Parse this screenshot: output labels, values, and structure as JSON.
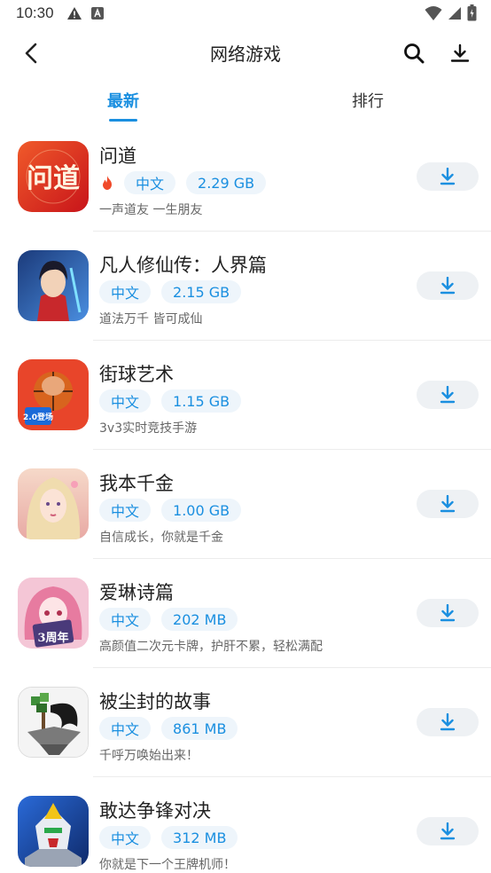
{
  "status": {
    "time": "10:30"
  },
  "appbar": {
    "title": "网络游戏"
  },
  "tabs": [
    {
      "label": "最新",
      "active": true
    },
    {
      "label": "排行",
      "active": false
    }
  ],
  "games": [
    {
      "name": "问道",
      "hot": true,
      "lang": "中文",
      "size": "2.29 GB",
      "desc": "一声道友 一生朋友",
      "icon": "wendao-icon"
    },
    {
      "name": "凡人修仙传：人界篇",
      "hot": false,
      "lang": "中文",
      "size": "2.15 GB",
      "desc": "道法万千 皆可成仙",
      "icon": "fanren-icon"
    },
    {
      "name": "街球艺术",
      "hot": false,
      "lang": "中文",
      "size": "1.15 GB",
      "desc": "3v3实时竞技手游",
      "icon": "jieqiu-icon"
    },
    {
      "name": "我本千金",
      "hot": false,
      "lang": "中文",
      "size": "1.00 GB",
      "desc": "自信成长，你就是千金",
      "icon": "qianjin-icon"
    },
    {
      "name": "爱琳诗篇",
      "hot": false,
      "lang": "中文",
      "size": "202 MB",
      "desc": "高颜值二次元卡牌，护肝不累，轻松满配",
      "icon": "ailin-icon"
    },
    {
      "name": "被尘封的故事",
      "hot": false,
      "lang": "中文",
      "size": "861 MB",
      "desc": "千呼万唤始出来！",
      "icon": "chenfeng-icon"
    },
    {
      "name": "敢达争锋对决",
      "hot": false,
      "lang": "中文",
      "size": "312 MB",
      "desc": "你就是下一个王牌机师！",
      "icon": "gundam-icon"
    }
  ],
  "icon_texts": {
    "wendao": "问道",
    "jieqiu": "2.0登场",
    "ailin": "3周年"
  },
  "colors": {
    "accent": "#1a8fe0",
    "tag_bg": "#eef5fb",
    "button_bg": "#eef1f4",
    "hot": "#f04a2a"
  }
}
